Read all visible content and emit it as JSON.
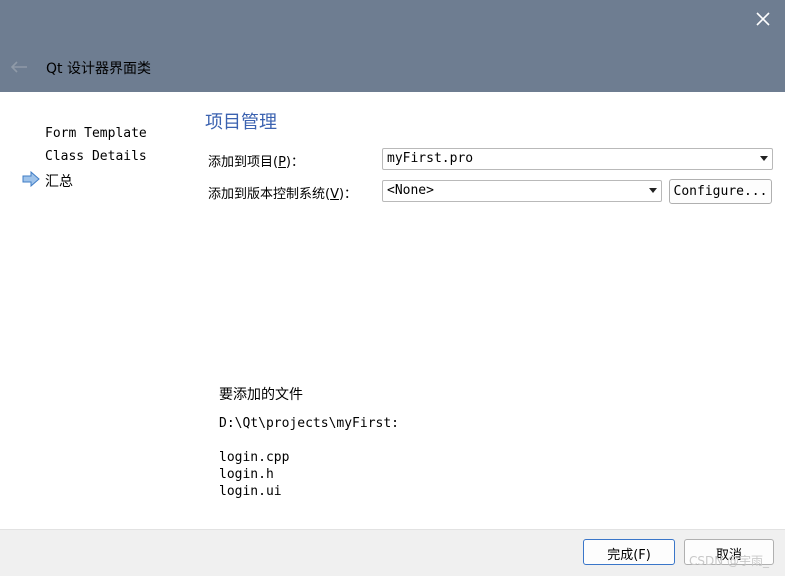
{
  "window": {
    "title": "Qt 设计器界面类"
  },
  "sidebar": {
    "items": [
      {
        "label": "Form Template",
        "current": false
      },
      {
        "label": "Class Details",
        "current": false
      },
      {
        "label": "汇总",
        "current": true
      }
    ]
  },
  "main": {
    "section_title": "项目管理",
    "add_to_project": {
      "label_prefix": "添加到项目(",
      "label_mnemonic": "P",
      "label_suffix": ")：",
      "value": "myFirst.pro"
    },
    "add_to_vcs": {
      "label_prefix": "添加到版本控制系统(",
      "label_mnemonic": "V",
      "label_suffix": ")：",
      "value": "<None>"
    },
    "configure_label": "Configure...",
    "files_heading": "要添加的文件",
    "files_dir": "D:\\Qt\\projects\\myFirst:",
    "files": [
      "login.cpp",
      "login.h",
      "login.ui"
    ]
  },
  "footer": {
    "finish_label": "完成(F)",
    "cancel_label": "取消"
  },
  "watermark": "CSDN @宇雨_"
}
